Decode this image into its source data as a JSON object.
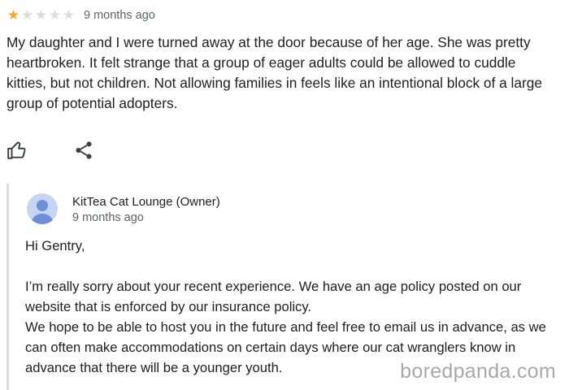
{
  "review": {
    "rating": 1,
    "max_rating": 5,
    "star_color": "#f9a825",
    "time_ago": "9 months ago",
    "text": "My daughter and I were turned away at the door because of her age. She was pretty heartbroken. It felt strange that a group of eager adults could be allowed to cuddle kitties, but not children. Not allowing families in feels like an intentional block of a large group of potential adopters."
  },
  "actions": {
    "like_icon": "thumbs-up-icon",
    "share_icon": "share-icon"
  },
  "owner_reply": {
    "owner_name": "KitTea Cat Lounge (Owner)",
    "time_ago": "9 months ago",
    "avatar_icon": "person-icon",
    "greeting": "Hi Gentry,",
    "paragraph1": "I’m really sorry about your recent experience. We have an age policy posted on our website that is enforced by our insurance policy.",
    "paragraph2": "We hope to be able to host you in the future and feel free to email us in advance, as we can often make accommodations on certain days where our cat wranglers know in advance that there will be a younger youth."
  },
  "watermark": "boredpanda.com"
}
